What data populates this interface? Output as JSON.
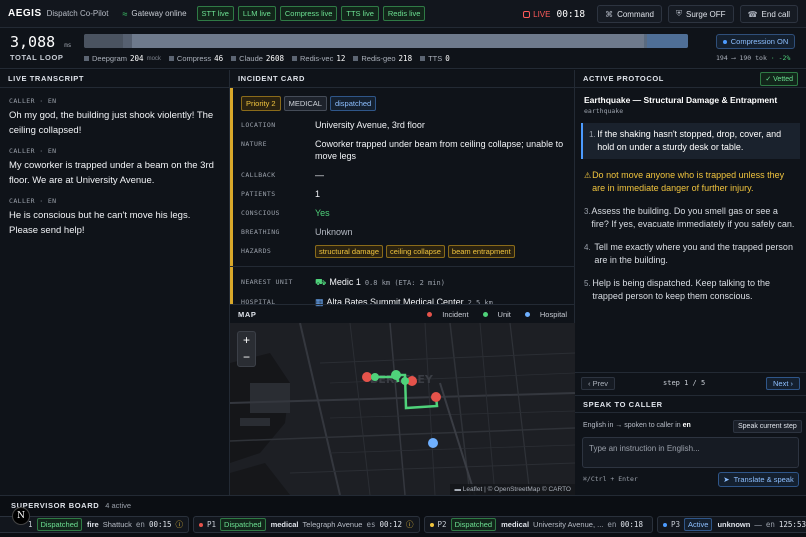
{
  "app": {
    "name": "AEGIS",
    "subtitle": "Dispatch Co-Pilot",
    "gateway": "Gateway online",
    "services": [
      "STT live",
      "LLM live",
      "Compress live",
      "TTS live",
      "Redis live"
    ],
    "live": "LIVE",
    "clock": "00:18",
    "command": "Command",
    "surge": "Surge OFF",
    "end_call": "End call"
  },
  "metrics": {
    "total": "3,088",
    "unit": "ms",
    "total_label": "TOTAL LOOP",
    "breakdown": [
      {
        "name": "Deepgram",
        "value": "204",
        "note": "mock"
      },
      {
        "name": "Compress",
        "value": "46"
      },
      {
        "name": "Claude",
        "value": "2608"
      },
      {
        "name": "Redis-vec",
        "value": "12"
      },
      {
        "name": "Redis-geo",
        "value": "218"
      },
      {
        "name": "TTS",
        "value": "0"
      }
    ],
    "compression": "Compression ON",
    "tokens": "194 ⟶ 190 tok",
    "tokens_delta": "· -2%"
  },
  "transcript": {
    "title": "LIVE TRANSCRIPT",
    "messages": [
      {
        "who": "CALLER · EN",
        "text": "Oh my god, the building just shook violently! The ceiling collapsed!"
      },
      {
        "who": "CALLER · EN",
        "text": "My coworker is trapped under a beam on the 3rd floor. We are at University Avenue."
      },
      {
        "who": "CALLER · EN",
        "text": "He is conscious but he can't move his legs. Please send help!"
      }
    ]
  },
  "incident": {
    "title": "INCIDENT CARD",
    "tags": [
      "Priority 2",
      "MEDICAL",
      "dispatched"
    ],
    "location_k": "LOCATION",
    "location": "University Avenue, 3rd floor",
    "nature_k": "NATURE",
    "nature": "Coworker trapped under beam from ceiling collapse; unable to move legs",
    "callback_k": "CALLBACK",
    "callback": "—",
    "patients_k": "PATIENTS",
    "patients": "1",
    "conscious_k": "CONSCIOUS",
    "conscious": "Yes",
    "breathing_k": "BREATHING",
    "breathing": "Unknown",
    "hazards_k": "HAZARDS",
    "hazards": [
      "structural damage",
      "ceiling collapse",
      "beam entrapment"
    ],
    "unit_k": "NEAREST UNIT",
    "unit": "Medic 1",
    "unit_eta": "0.8 km (ETA: 2 min)",
    "hospital_k": "HOSPITAL",
    "hospital": "Alta Bates Summit Medical Center",
    "hospital_dist": "2.5 km"
  },
  "map": {
    "title": "MAP",
    "legend": [
      {
        "label": "Incident",
        "color": "#e5534b"
      },
      {
        "label": "Unit",
        "color": "#4fd27a"
      },
      {
        "label": "Hospital",
        "color": "#6fb0ff"
      }
    ],
    "zoom_in": "+",
    "zoom_out": "−",
    "attribution": "▬ Leaflet | © OpenStreetMap © CARTO"
  },
  "protocol": {
    "title": "ACTIVE PROTOCOL",
    "vetted": "Vetted",
    "name": "Earthquake — Structural Damage & Entrapment",
    "code": "earthquake",
    "steps": [
      {
        "n": "1.",
        "text": "If the shaking hasn't stopped, drop, cover, and hold on under a sturdy desk or table."
      },
      {
        "n": "⚠",
        "text": "Do not move anyone who is trapped unless they are in immediate danger of further injury."
      },
      {
        "n": "3.",
        "text": "Assess the building. Do you smell gas or see a fire? If yes, evacuate immediately if you safely can."
      },
      {
        "n": "4.",
        "text": "Tell me exactly where you and the trapped person are in the building."
      },
      {
        "n": "5.",
        "text": "Help is being dispatched. Keep talking to the trapped person to keep them conscious."
      }
    ],
    "prev": "‹ Prev",
    "step_indicator": "step 1 / 5",
    "next": "Next ›"
  },
  "speak": {
    "title": "SPEAK TO CALLER",
    "route_pre": "English in → spoken to caller in ",
    "route_lang": "en",
    "current": "Speak current step",
    "placeholder": "Type an instruction in English...",
    "hint": "⌘/Ctrl + Enter",
    "button": "Translate & speak"
  },
  "supervisor": {
    "title": "SUPERVISOR BOARD",
    "active": "4 active",
    "cases": [
      {
        "p": "1",
        "status": "Dispatched",
        "type": "fire",
        "loc": "Shattuck",
        "lang": "en",
        "time": "00:15",
        "dot": "#e5534b"
      },
      {
        "p": "P1",
        "status": "Dispatched",
        "type": "medical",
        "loc": "Telegraph Avenue",
        "lang": "es",
        "time": "00:12",
        "dot": "#e5534b"
      },
      {
        "p": "P2",
        "status": "Dispatched",
        "type": "medical",
        "loc": "University Avenue, ...",
        "lang": "en",
        "time": "00:18",
        "dot": "#f0c43e"
      },
      {
        "p": "P3",
        "status": "Active",
        "type": "unknown",
        "loc": "—",
        "lang": "en",
        "time": "125:53",
        "dot": "#4c9bff"
      }
    ]
  }
}
